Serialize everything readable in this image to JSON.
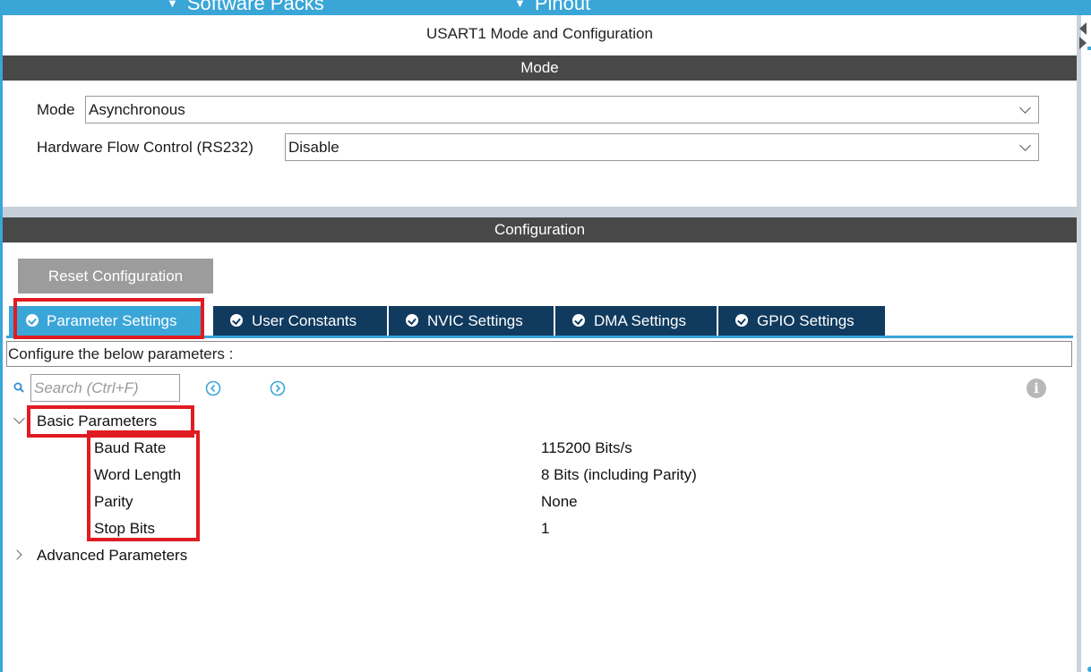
{
  "top_menu": {
    "item1": "Software Packs",
    "item2": "Pinout"
  },
  "panel": {
    "title": "USART1 Mode and Configuration"
  },
  "mode_section": {
    "header": "Mode",
    "mode_label": "Mode",
    "mode_value": "Asynchronous",
    "flow_label": "Hardware Flow Control (RS232)",
    "flow_value": "Disable"
  },
  "config_section": {
    "header": "Configuration",
    "reset_button": "Reset Configuration",
    "tabs": [
      {
        "label": "Parameter Settings",
        "active": true
      },
      {
        "label": "User Constants",
        "active": false
      },
      {
        "label": "NVIC Settings",
        "active": false
      },
      {
        "label": "DMA Settings",
        "active": false
      },
      {
        "label": "GPIO Settings",
        "active": false
      }
    ],
    "description": "Configure the below parameters :",
    "search_placeholder": "Search (Ctrl+F)",
    "info_symbol": "i"
  },
  "tree": {
    "basic_group": "Basic Parameters",
    "params": [
      {
        "name": "Baud Rate",
        "value": "115200 Bits/s"
      },
      {
        "name": "Word Length",
        "value": "8 Bits (including Parity)"
      },
      {
        "name": "Parity",
        "value": "None"
      },
      {
        "name": "Stop Bits",
        "value": "1"
      }
    ],
    "advanced_group": "Advanced Parameters"
  },
  "colors": {
    "top_bar": "#3aa6d8",
    "section_header": "#484848",
    "tab_active": "#3aa6d8",
    "tab_inactive": "#103a5e",
    "highlight_box": "#e11b22"
  },
  "icons": {
    "tab_status": "check-circle-icon",
    "search": "search-icon",
    "prev": "prev-circle-icon",
    "next": "next-circle-icon",
    "info": "info-icon",
    "expand": "chevron-down-icon",
    "collapse": "chevron-right-icon"
  }
}
